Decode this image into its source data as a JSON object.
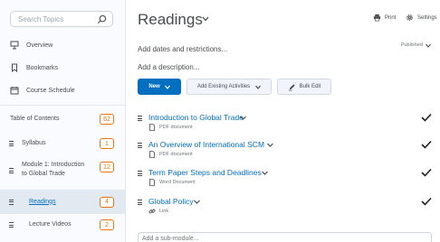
{
  "sidebar": {
    "search_placeholder": "Search Topics",
    "nav": [
      {
        "label": "Overview",
        "icon": "presentation-icon"
      },
      {
        "label": "Bookmarks",
        "icon": "bookmark-icon"
      },
      {
        "label": "Course Schedule",
        "icon": "calendar-icon"
      }
    ],
    "toc": {
      "label": "Table of Contents",
      "count": "62"
    },
    "modules": [
      {
        "label": "Syllabus",
        "count": "1"
      },
      {
        "label_line1": "Module 1: Introduction",
        "label_line2": "to Global Trade",
        "count": "12"
      },
      {
        "label": "Readings",
        "count": "4",
        "active": true
      },
      {
        "label": "Lecture Videos",
        "count": "2"
      }
    ]
  },
  "main": {
    "title": "Readings",
    "toolbar": {
      "print_label": "Print",
      "settings_label": "Settings"
    },
    "add_dates": "Add dates and restrictions...",
    "status": "Published",
    "add_description": "Add a description...",
    "buttons": {
      "new": "New",
      "add_existing": "Add Existing Activities",
      "bulk_edit": "Bulk Edit"
    },
    "topics": [
      {
        "name": "Introduction to Global Trade",
        "type": "PDF document",
        "icon": "document-icon"
      },
      {
        "name": "An Overview of International SCM",
        "type": "PDF document",
        "icon": "document-icon"
      },
      {
        "name": "Term Paper Steps and Deadlines",
        "type": "Word Document",
        "icon": "document-icon"
      },
      {
        "name": "Global Policy",
        "type": "Link",
        "icon": "link-icon"
      }
    ],
    "add_submodule": "Add a sub-module..."
  },
  "colors": {
    "accent": "#006fbf",
    "badge": "#e87511",
    "sidebar_bg": "#f9fbff"
  }
}
